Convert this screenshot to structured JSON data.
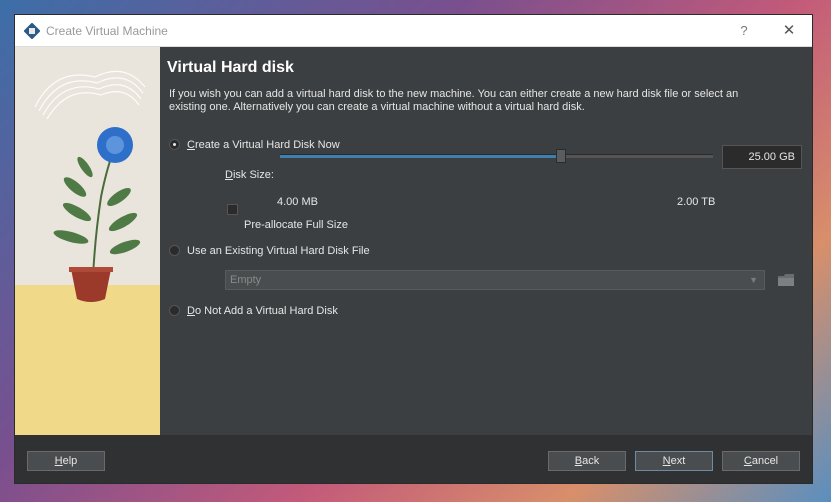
{
  "window": {
    "title": "Create Virtual Machine",
    "help_glyph": "?",
    "close_glyph": "✕"
  },
  "page": {
    "heading": "Virtual Hard disk",
    "description": "If you wish you can add a virtual hard disk to the new machine. You can either create a new hard disk file or select an existing one. Alternatively you can create a virtual machine without a virtual hard disk."
  },
  "options": {
    "create_now": {
      "label": "Create a Virtual Hard Disk Now",
      "selected": true
    },
    "use_existing": {
      "label": "Use an Existing Virtual Hard Disk File",
      "selected": false
    },
    "do_not_add": {
      "label": "Do Not Add a Virtual Hard Disk",
      "selected": false
    }
  },
  "disk": {
    "size_label": "Disk Size:",
    "size_value": "25.00 GB",
    "min_label": "4.00 MB",
    "max_label": "2.00 TB",
    "slider_fraction": 0.65,
    "preallocate_label": "Pre-allocate Full Size",
    "preallocate_checked": false
  },
  "existing": {
    "combo_value": "Empty"
  },
  "buttons": {
    "help": "Help",
    "back": "Back",
    "next": "Next",
    "cancel": "Cancel"
  },
  "colors": {
    "accent": "#3f7fb0",
    "dialog_bg": "#3c3f41",
    "flower": "#2d6fc9"
  }
}
